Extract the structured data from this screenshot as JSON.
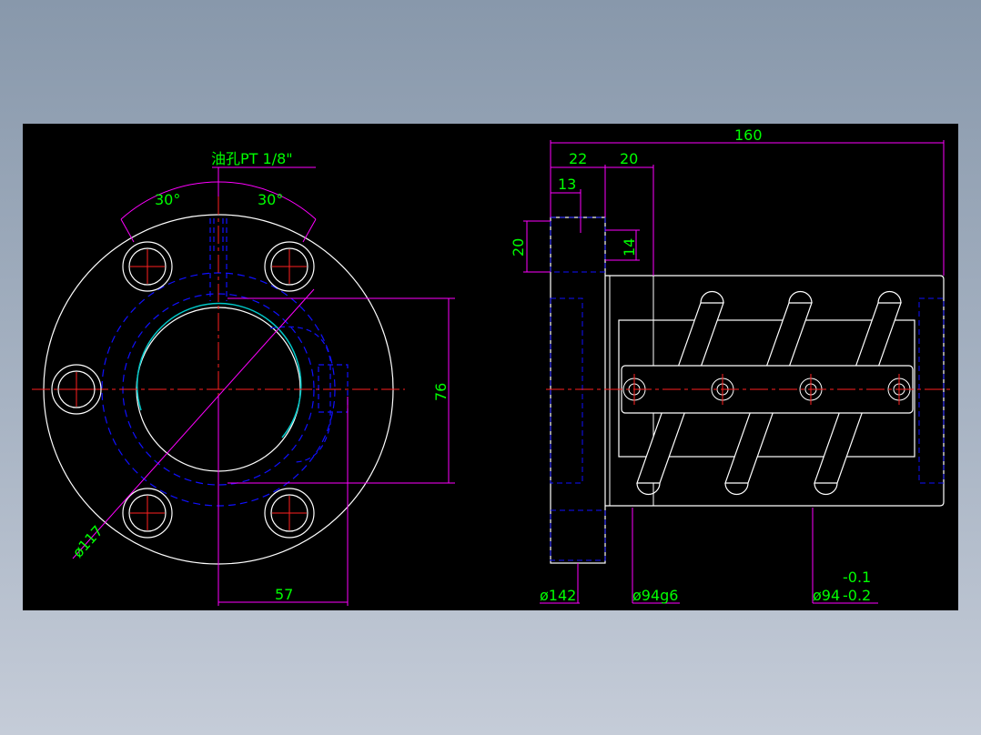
{
  "colors": {
    "background": "#000000",
    "outline": "#ffffff",
    "hidden": "#1010ff",
    "centerline": "#ff2020",
    "dimension": "#ff00ff",
    "text": "#00ff00",
    "arc": "#00c8c8"
  },
  "front_view": {
    "oil_hole_label": "油孔PT 1/8\"",
    "angle_left": "30°",
    "angle_right": "30°",
    "bolt_circle": "ø117",
    "dim_height": "76",
    "dim_width": "57"
  },
  "side_view": {
    "overall_length": "160",
    "flange_thickness": "22",
    "step": "20",
    "hole_offset": "13",
    "hole_height": "20",
    "hole_depth": "14",
    "flange_dia": "ø142",
    "pilot_dia": "ø94g6",
    "body_dia": "ø94",
    "tol_upper": "-0.1",
    "tol_lower": "-0.2"
  }
}
